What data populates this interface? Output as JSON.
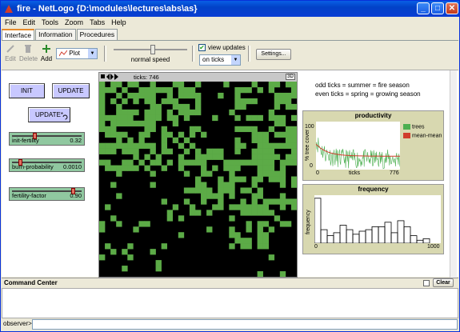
{
  "window": {
    "title": "fire - NetLogo {D:\\modules\\lectures\\abs\\as}"
  },
  "menu": [
    "File",
    "Edit",
    "Tools",
    "Zoom",
    "Tabs",
    "Help"
  ],
  "tabs": [
    "Interface",
    "Information",
    "Procedures"
  ],
  "toolbar": {
    "edit": "Edit",
    "delete": "Delete",
    "add": "Add",
    "widget_type": "Plot",
    "speed_label": "normal speed",
    "view_updates_label": "view updates",
    "view_updates_checked": true,
    "update_mode": "on ticks",
    "settings": "Settings..."
  },
  "buttons": {
    "init": "INIT",
    "update": "UPDATE",
    "update_forever": "UPDATE*"
  },
  "sliders": [
    {
      "label": "init-fertility",
      "value": "0.32",
      "fraction": 0.32
    },
    {
      "label": "burn-probability",
      "value": "0.0010",
      "fraction": 0.1
    },
    {
      "label": "fertility-factor",
      "value": "0.90",
      "fraction": 0.9
    }
  ],
  "view": {
    "ticks_label": "ticks: 746",
    "three_d": "3D"
  },
  "notes": {
    "line1": "odd ticks = summer = fire season",
    "line2": "even ticks = spring = growing season"
  },
  "productivity_plot": {
    "title": "productivity",
    "xlabel": "ticks",
    "ylabel": "% tree cover",
    "ymax": "100",
    "ymin": "0",
    "xmin": "0",
    "xmax": "776",
    "legend": [
      {
        "name": "trees",
        "color": "#4caf50"
      },
      {
        "name": "mean-mean",
        "color": "#d03c2c"
      }
    ]
  },
  "frequency_plot": {
    "title": "frequency",
    "ylabel": "frequency",
    "xmin": "0",
    "xmax": "1000"
  },
  "chart_data": [
    {
      "type": "line",
      "title": "productivity",
      "xlabel": "ticks",
      "ylabel": "% tree cover",
      "xlim": [
        0,
        776
      ],
      "ylim": [
        0,
        100
      ],
      "series": [
        {
          "name": "trees",
          "color": "#4caf50"
        },
        {
          "name": "mean-mean",
          "color": "#d03c2c"
        }
      ]
    },
    {
      "type": "bar",
      "title": "frequency",
      "ylabel": "frequency",
      "xlim": [
        0,
        1000
      ],
      "values": [
        30,
        9,
        5,
        7,
        12,
        9,
        6,
        8,
        9,
        11,
        11,
        14,
        7,
        15,
        11,
        5,
        2,
        3
      ]
    }
  ],
  "command_center": {
    "title": "Command Center",
    "clear": "Clear",
    "prompt": "observer>"
  },
  "colors": {
    "patch_green": "#5cab47",
    "button_bg": "#c8c8ff",
    "slider_bg": "#90c8a0",
    "plot_bg": "#d8d8b0"
  }
}
